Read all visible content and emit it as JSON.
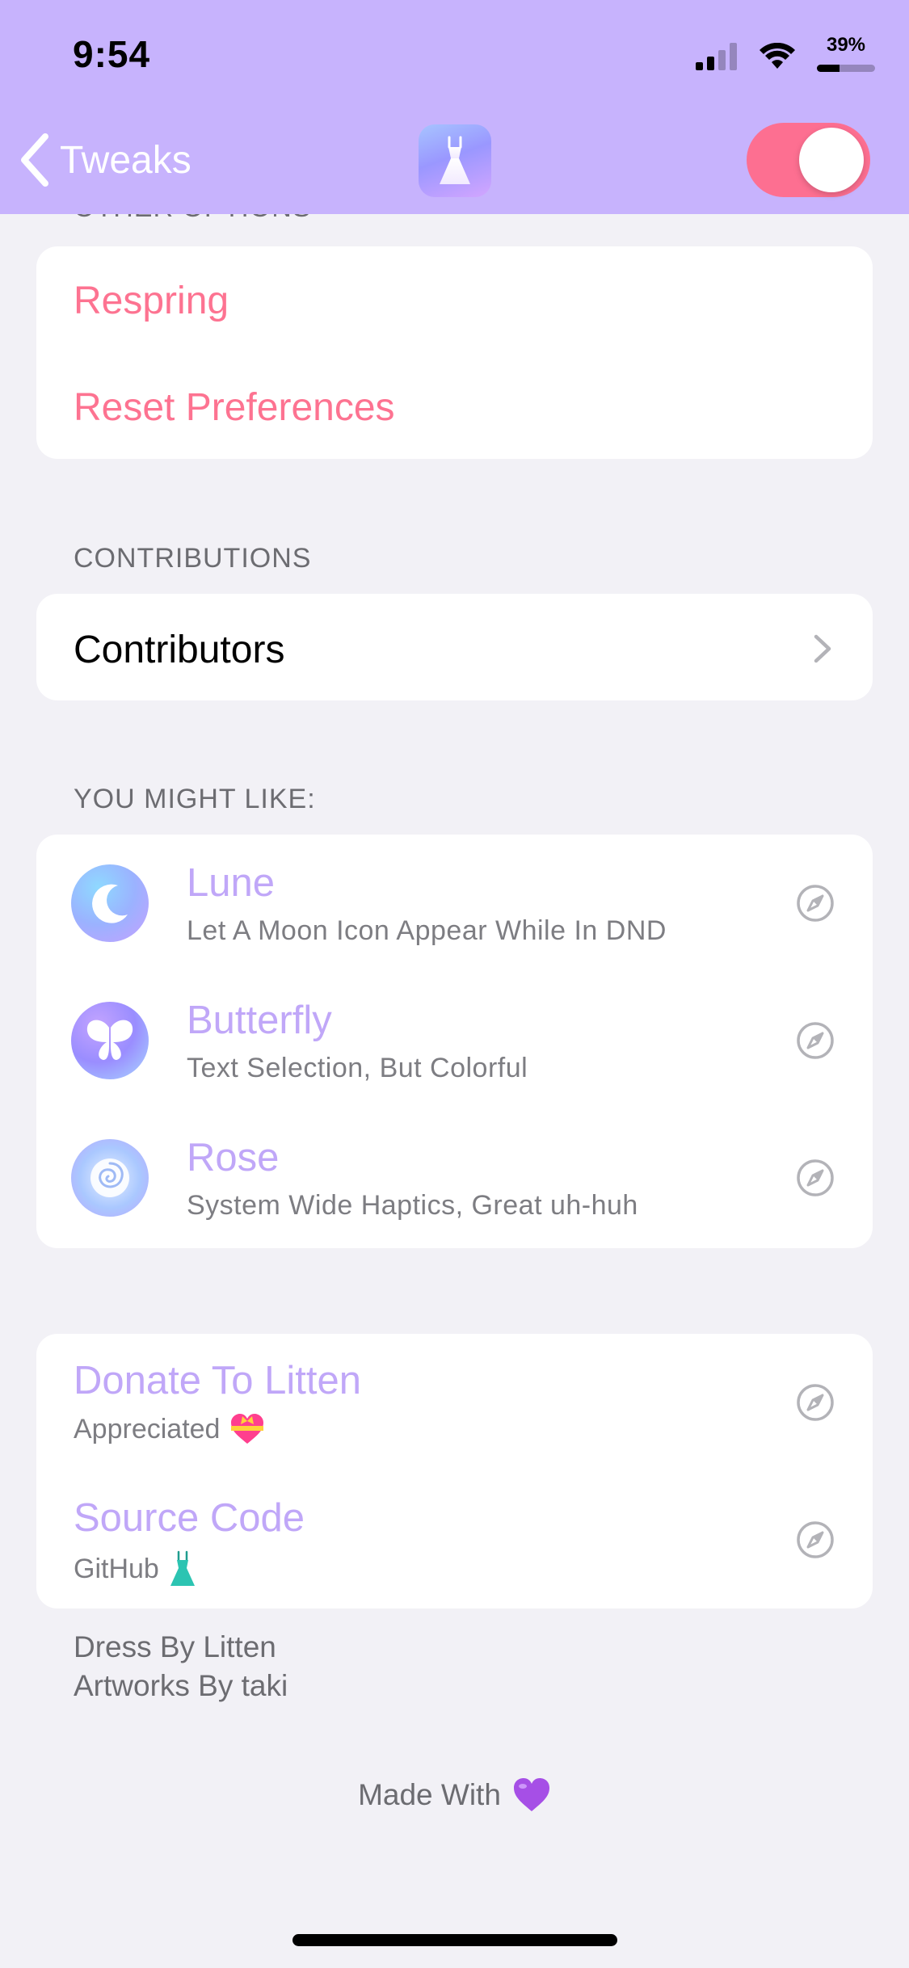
{
  "status_bar": {
    "time": "9:54",
    "battery_percent": "39%",
    "battery_level": 0.39
  },
  "nav": {
    "back_label": "Tweaks",
    "toggle_on": true,
    "accent_color": "#fd6f91",
    "bar_color": "#c7b3fd"
  },
  "sections": {
    "other_options": {
      "header": "OTHER OPTIONS",
      "respring_label": "Respring",
      "reset_label": "Reset Preferences"
    },
    "contributions": {
      "header": "CONTRIBUTIONS",
      "contributors_label": "Contributors"
    },
    "you_might_like": {
      "header": "YOU MIGHT LIKE:",
      "items": [
        {
          "name": "Lune",
          "description": "Let A Moon Icon Appear While In DND",
          "icon": "moon-icon"
        },
        {
          "name": "Butterfly",
          "description": "Text Selection, But Colorful",
          "icon": "butterfly-icon"
        },
        {
          "name": "Rose",
          "description": "System Wide Haptics, Great uh-huh",
          "icon": "rose-icon"
        }
      ]
    },
    "links": {
      "items": [
        {
          "title": "Donate To Litten",
          "subtitle": "Appreciated",
          "emoji": "heart-with-ribbon"
        },
        {
          "title": "Source Code",
          "subtitle": "GitHub",
          "emoji": "dress"
        }
      ]
    }
  },
  "footer": {
    "credits_line1": "Dress By Litten",
    "credits_line2": "Artworks By taki",
    "made_with": "Made With",
    "made_with_emoji": "purple-heart"
  },
  "colors": {
    "link_purple": "#c0a7f8",
    "action_pink": "#fd7391",
    "background": "#f2f1f6"
  }
}
